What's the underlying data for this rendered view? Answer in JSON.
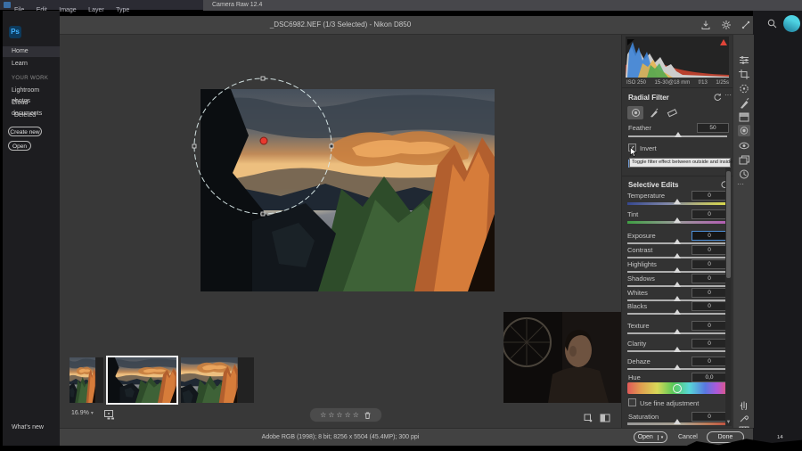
{
  "colors": {
    "accent_blue": "#4e8fd6",
    "avatar_cyan": "#3ec6da",
    "pin_red": "#e8392e",
    "panel_bg": "#333333",
    "tooltip_bg": "#e6e6e6"
  },
  "menu_bar": {
    "items": [
      "File",
      "Edit",
      "Image",
      "Layer",
      "Type"
    ],
    "camera_raw_tab": "Camera Raw 12.4"
  },
  "home_header": {
    "search_icon": "magnifier",
    "avatar": "user-avatar"
  },
  "sidebar": {
    "logo": "Ps",
    "items": [
      "Home",
      "Learn"
    ],
    "section_label": "YOUR WORK",
    "section_items": [
      "Lightroom photos",
      "Cloud documents",
      "Deleted"
    ],
    "create_button": "Create new",
    "open_button": "Open",
    "whats_new": "What's new"
  },
  "dialog": {
    "title": "_DSC6982.NEF (1/3 Selected)  -  Nikon D850",
    "titlebar_icons": [
      "export",
      "settings",
      "toggle-fullscreen"
    ]
  },
  "exif": {
    "iso": "ISO 250",
    "lens": "15-30@18 mm",
    "aperture": "f/13",
    "shutter": "1/25s"
  },
  "toolbar_icons": [
    "edit-sliders",
    "crop-rotate",
    "spot-heal",
    "adjustment-brush",
    "graduated-filter",
    "radial-filter",
    "red-eye",
    "presets",
    "snapshots",
    "more-options"
  ],
  "toolbar_bottom_icons": [
    "hand-tool",
    "white-balance-sampler",
    "grid-overlay"
  ],
  "radial_filter": {
    "title": "Radial Filter",
    "tools": [
      "radial-new",
      "brush-add",
      "brush-erase"
    ],
    "feather": {
      "label": "Feather",
      "value": "50"
    },
    "invert_label": "Invert",
    "tooltip": "Toggle filter effect between outside and inside"
  },
  "selective_edits": {
    "title": "Selective Edits",
    "rows": [
      {
        "label": "Temperature",
        "value": "0"
      },
      {
        "label": "Tint",
        "value": "0"
      },
      {
        "label": "Exposure",
        "value": "0"
      },
      {
        "label": "Contrast",
        "value": "0"
      },
      {
        "label": "Highlights",
        "value": "0"
      },
      {
        "label": "Shadows",
        "value": "0"
      },
      {
        "label": "Whites",
        "value": "0"
      },
      {
        "label": "Blacks",
        "value": "0"
      },
      {
        "label": "Texture",
        "value": "0"
      },
      {
        "label": "Clarity",
        "value": "0"
      },
      {
        "label": "Dehaze",
        "value": "0"
      }
    ],
    "hue": {
      "label": "Hue",
      "value": "0,0"
    },
    "fine_adjustment_label": "Use fine adjustment",
    "saturation": {
      "label": "Saturation",
      "value": "0"
    }
  },
  "preview": {
    "zoom_level": "16.9%",
    "rating_stars": 5,
    "star_glyph": "☆",
    "thumbnails_count": 3,
    "selected_thumbnail": 2
  },
  "footer": {
    "info": "Adobe RGB (1998); 8 bit; 8256 x 5504 (45.4MP); 300 ppi",
    "open": "Open",
    "cancel": "Cancel",
    "done": "Done"
  },
  "overlay_video": {
    "watermark": "14"
  }
}
